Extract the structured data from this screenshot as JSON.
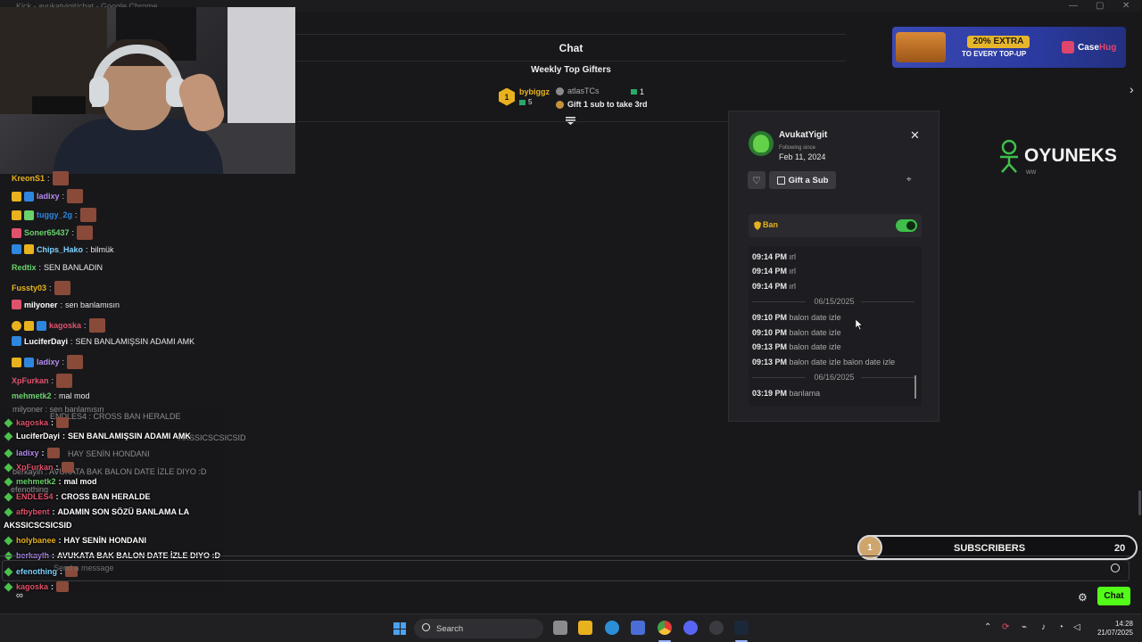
{
  "window": {
    "title": "Kick - avukatyigit/chat - Google Chrome",
    "minimize": "—",
    "maximize": "▢",
    "close": "✕"
  },
  "chat": {
    "title": "Chat"
  },
  "top_gifters": {
    "title": "Weekly Top Gifters",
    "first": {
      "rank": "1",
      "name": "bybiggz",
      "count": "5"
    },
    "second": {
      "name": "atlasTCs",
      "count": "1",
      "cta": "Gift 1 sub to take 3rd"
    }
  },
  "ad": {
    "headline": "20% EXTRA",
    "subline": "TO EVERY TOP-UP",
    "brand_a": "Case",
    "brand_b": "Hug"
  },
  "sponsor": {
    "name": "OYUNEKS",
    "tag": "WW"
  },
  "user_card": {
    "username": "AvukatYigit",
    "following_label": "Following since",
    "following_date": "Feb 11, 2024",
    "gift_button": "Gift a Sub",
    "ban_label": "Ban",
    "ban_enabled": true,
    "logs": [
      {
        "time": "09:14 PM",
        "text": "ırl"
      },
      {
        "time": "09:14 PM",
        "text": "ırl"
      },
      {
        "time": "09:14 PM",
        "text": "ırl"
      },
      {
        "date": "06/15/2025"
      },
      {
        "time": "09:10 PM",
        "text": "balon date izle"
      },
      {
        "time": "09:10 PM",
        "text": "balon date izle"
      },
      {
        "time": "09:13 PM",
        "text": "balon date izle"
      },
      {
        "time": "09:13 PM",
        "text": "balon date izle balon date izle"
      },
      {
        "date": "06/16/2025"
      },
      {
        "time": "03:19 PM",
        "text": "banlama"
      }
    ]
  },
  "left_chat": [
    {
      "user": "KreonS1",
      "color": "#e8b21e",
      "badges": [],
      "msg": "",
      "emote": true
    },
    {
      "user": "ladixy",
      "color": "#b48af0",
      "badges": [
        "crown",
        "blue"
      ],
      "msg": "",
      "emote": true
    },
    {
      "user": "tuggy_2g",
      "color": "#2e86de",
      "badges": [
        "crown",
        "sub"
      ],
      "msg": "",
      "emote": true
    },
    {
      "user": "Soner65437",
      "color": "#6bd16b",
      "badges": [
        "pink"
      ],
      "msg": "",
      "emote": true
    },
    {
      "user": "Chips_Hako",
      "color": "#7fd1ff",
      "badges": [
        "blue",
        "crown"
      ],
      "msg": "bilmük",
      "emote": false
    },
    {
      "user": "Redtix",
      "color": "#6bd16b",
      "badges": [],
      "msg": "SEN BANLADIN",
      "emote": false
    },
    {
      "user": "Fussty03",
      "color": "#e8b21e",
      "badges": [],
      "msg": "",
      "emote": true
    },
    {
      "user": "milyoner",
      "color": "#ffffff",
      "badges": [
        "pink"
      ],
      "msg": "sen banlamısın",
      "emote": false
    },
    {
      "user": "kagoska",
      "color": "#e0526c",
      "badges": [
        "round",
        "crown",
        "blue"
      ],
      "msg": "",
      "emote": true
    },
    {
      "user": "LuciferDayi",
      "color": "#ffffff",
      "badges": [
        "blue"
      ],
      "msg": "SEN BANLAMIŞSIN ADAMI AMK",
      "emote": false
    },
    {
      "user": "ladixy",
      "color": "#b48af0",
      "badges": [
        "crown",
        "blue"
      ],
      "msg": "",
      "emote": true
    },
    {
      "user": "XpFurkan",
      "color": "#e0526c",
      "badges": [],
      "msg": "",
      "emote": true
    },
    {
      "user": "mehmetk2",
      "color": "#6bd16b",
      "badges": [],
      "msg": "mal mod",
      "emote": false
    }
  ],
  "overlay_chat": [
    {
      "user": "kagoska",
      "color": "#e0526c",
      "msg": "",
      "emote": true
    },
    {
      "user": "LuciferDayi",
      "color": "#ffffff",
      "msg": "SEN BANLAMIŞSIN ADAMI AMK",
      "emote": false
    },
    {
      "user": "ladixy",
      "color": "#b48af0",
      "msg": "",
      "emote": true
    },
    {
      "user": "XpFurkan",
      "color": "#e0526c",
      "msg": "",
      "emote": true
    },
    {
      "user": "mehmetk2",
      "color": "#6bd16b",
      "msg": "mal mod",
      "emote": false
    },
    {
      "user": "ENDLES4",
      "color": "#e0526c",
      "msg": "CROSS BAN HERALDE",
      "emote": false
    },
    {
      "user": "afbybent",
      "color": "#e0526c",
      "msg": "ADAMIN SON SÖZÜ BANLAMA LA",
      "emote": false
    },
    {
      "user": "",
      "color": "#ffffff",
      "msg": "AKSSICSCSICSID",
      "emote": false
    },
    {
      "user": "holybanee",
      "color": "#e8b21e",
      "msg": "HAY SENİN HONDANI",
      "emote": false
    },
    {
      "user": "berkaylh",
      "color": "#b48af0",
      "msg": "AVUKATA BAK BALON DATE İZLE DIYO :D",
      "emote": false
    },
    {
      "user": "efenothing",
      "color": "#7fd1ff",
      "msg": "",
      "emote": true
    },
    {
      "user": "kagoska",
      "color": "#e0526c",
      "msg": "",
      "emote": true
    }
  ],
  "ghost_chat": [
    {
      "text": "milyoner : sen banlamısın"
    },
    {
      "text": "ENDLES4 : CROSS BAN HERALDE"
    },
    {
      "text": "AKSSICSCSICSID"
    },
    {
      "text": "HAY SENİN HONDANI"
    },
    {
      "text": "berkaylh : AVUKATA BAK BALON DATE İZLE DIYO :D"
    },
    {
      "text": "efenothing"
    }
  ],
  "subs_goal": {
    "level": "1",
    "label": "SUBSCRIBERS",
    "count": "20"
  },
  "input": {
    "placeholder": "Send a message",
    "send_label": "Chat",
    "infinity": "∞"
  },
  "taskbar": {
    "search_label": "Search",
    "time": "14:28",
    "date": "21/07/2025"
  }
}
